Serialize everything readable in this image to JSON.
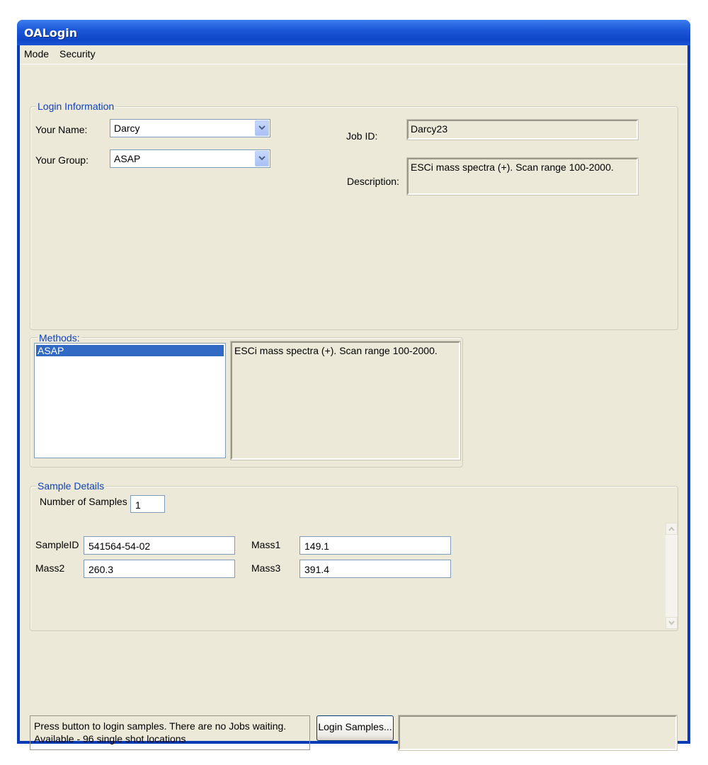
{
  "window": {
    "title": "OALogin"
  },
  "menu": {
    "items": [
      "Mode",
      "Security"
    ]
  },
  "login_info": {
    "legend": "Login Information",
    "name_label": "Your Name:",
    "name_value": "Darcy",
    "group_label": "Your Group:",
    "group_value": "ASAP",
    "job_id_label": "Job ID:",
    "job_id_value": "Darcy23",
    "description_label": "Description:",
    "description_value": "ESCi mass spectra (+). Scan range 100-2000."
  },
  "methods": {
    "legend": "Methods:",
    "list": [
      "ASAP"
    ],
    "selected": "ASAP",
    "description": "ESCi mass spectra (+). Scan range 100-2000."
  },
  "sample_details": {
    "legend": "Sample Details",
    "count_label": "Number of Samples",
    "count_value": "1",
    "sample_id_label": "SampleID",
    "sample_id_value": "541564-54-02",
    "mass1_label": "Mass1",
    "mass1_value": "149.1",
    "mass2_label": "Mass2",
    "mass2_value": "260.3",
    "mass3_label": "Mass3",
    "mass3_value": "391.4"
  },
  "status": {
    "line1": "Press button to login samples. There are no Jobs waiting.",
    "line2": "Available - 96 single shot locations",
    "login_button": "Login Samples...",
    "progress_text": ""
  },
  "colors": {
    "titlebar": "#0f46c8",
    "client_bg": "#ece9d8",
    "group_label": "#1241b8",
    "selection": "#316ac5"
  }
}
